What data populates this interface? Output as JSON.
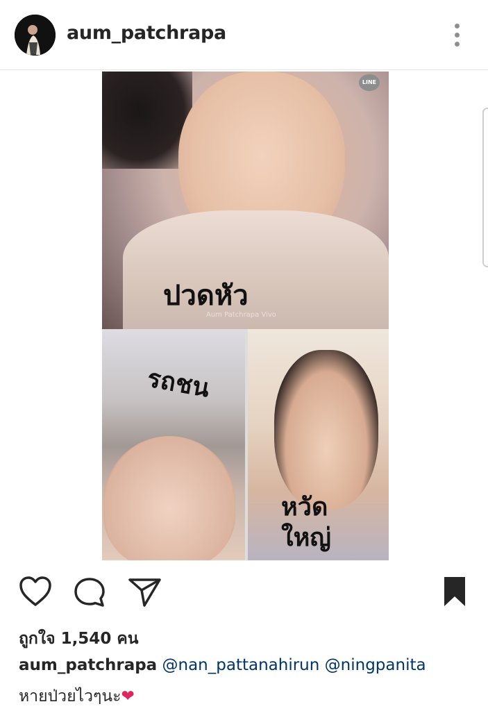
{
  "post": {
    "username": "aum_patchrapa",
    "media": {
      "watermark_logo": "LINE",
      "watermark_text": "Aum Patchrapa Vivo",
      "captions": {
        "top": "ปวดหัว",
        "bottom_left": "รถชน",
        "bottom_right_line1": "หวัด",
        "bottom_right_line2": "ใหญ่"
      }
    },
    "actions": {
      "like_icon": "heart-outline-icon",
      "comment_icon": "comment-bubble-icon",
      "share_icon": "send-paper-plane-icon",
      "save_icon": "bookmark-filled-icon"
    },
    "likes_text": "ถูกใจ 1,540 คน",
    "caption": {
      "username": "aum_patchrapa",
      "mention_1": "@nan_pattanahirun",
      "mention_2": "@ningpanita",
      "text": "หายป่วยไวๆนะ",
      "emoji": "❤"
    }
  },
  "colors": {
    "text": "#262626",
    "mention": "#003569",
    "icon": "#262626",
    "divider": "#e6e6e6"
  }
}
